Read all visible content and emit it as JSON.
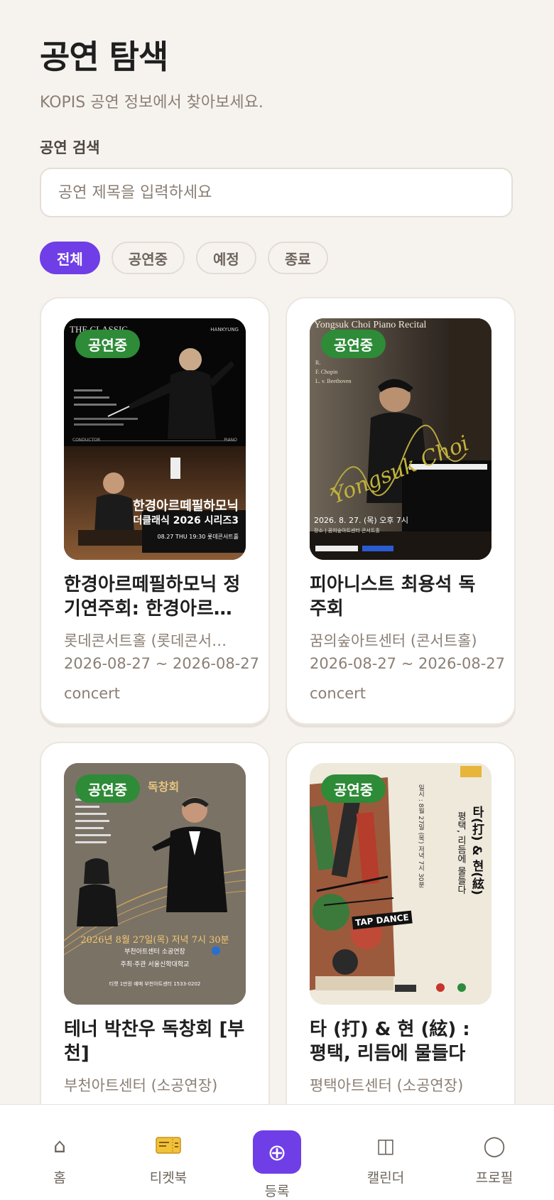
{
  "header": {
    "title": "공연 탐색",
    "subtitle": "KOPIS 공연 정보에서 찾아보세요."
  },
  "search": {
    "label": "공연 검색",
    "placeholder": "공연 제목을 입력하세요",
    "value": ""
  },
  "filters": [
    {
      "label": "전체",
      "active": true
    },
    {
      "label": "공연중",
      "active": false
    },
    {
      "label": "예정",
      "active": false
    },
    {
      "label": "종료",
      "active": false
    }
  ],
  "performances": [
    {
      "status": "공연중",
      "title": "한경아르떼필하모닉 정기연주회: 한경아르…",
      "venue": "롯데콘서트홀 (롯데콘서…",
      "dates": "2026-08-27 ~ 2026-08-27",
      "category": "concert",
      "poster": {
        "top_text": "THE CLASSIC",
        "logo_text": "HANKYUNG",
        "main_text": "한경아르떼필하모닉",
        "sub_text": "더클래식 2026 시리즈3",
        "date_text": "08.27 THU 19:30 롯데콘서트홀",
        "conductor_text": "CONDUCTOR",
        "piano_text": "PIANO"
      }
    },
    {
      "status": "공연중",
      "title": "피아니스트 최용석 독주회",
      "venue": "꿈의숲아트센터 (콘서트홀)",
      "dates": "2026-08-27 ~ 2026-08-27",
      "category": "concert",
      "poster": {
        "top_text": "Yongsuk Choi Piano Recital",
        "program": [
          "R.",
          "F. Chopin",
          "L. v. Beethoven"
        ],
        "script_text": "Yongsuk Choi",
        "date_text": "2026. 8. 27. (목) 오후 7시",
        "place_text": "장소 | 꿈의숲아트센터 콘서트홀"
      }
    },
    {
      "status": "공연중",
      "title": "테너 박찬우 독창회 [부천]",
      "venue": "부천아트센터 (소공연장)",
      "dates": "",
      "category": "",
      "poster": {
        "top_text": "독창회",
        "date_text": "2026년 8월 27일(목) 저녁 7시 30분",
        "place_text": "부천아트센터 소공연장",
        "host_text": "주최·주관  서울신학대학교",
        "info_text": "티켓 1만원   예매 부천아트센터 1533-0202"
      }
    },
    {
      "status": "공연중",
      "title": "타 (打) & 현 (絃) : 평택, 리듬에 물들다",
      "venue": "평택아트센터 (소공연장)",
      "dates": "",
      "category": "",
      "poster": {
        "vertical_title": "타(打) & 현(絃)",
        "vertical_sub": "평택, 리듬에 물들다",
        "vertical_info": "일시 : 8월 27일 (목) 저녁 7시 30분",
        "tap_text": "TAP DANCE"
      }
    }
  ],
  "nav": [
    {
      "label": "홈",
      "icon": "home-icon",
      "glyph": "⌂"
    },
    {
      "label": "티켓북",
      "icon": "ticket-icon",
      "glyph": ""
    },
    {
      "label": "등록",
      "icon": "plus-circle-icon",
      "glyph": "⊕"
    },
    {
      "label": "캘린더",
      "icon": "book-icon",
      "glyph": "◫"
    },
    {
      "label": "프로필",
      "icon": "profile-circle-icon",
      "glyph": "◯"
    }
  ],
  "colors": {
    "accent": "#6f3ee6",
    "status_badge": "#2e8b38",
    "background": "#f6f3ef"
  }
}
